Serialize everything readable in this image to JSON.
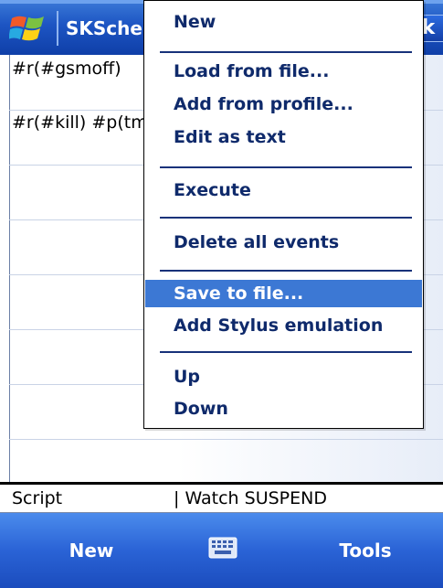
{
  "titlebar": {
    "title": "SKSchel",
    "ok_label": "k",
    "start_icon": "windows-flag-icon"
  },
  "list": {
    "rows": [
      {
        "text": "#r(#gsmoff)"
      },
      {
        "text": "#r(#kill) #p(tm"
      }
    ]
  },
  "statusbar": {
    "left": "Script",
    "right": "| Watch SUSPEND"
  },
  "menubar": {
    "left_label": "New",
    "right_label": "Tools",
    "keyboard_icon": "keyboard-icon"
  },
  "menu": {
    "items": [
      {
        "label": "New"
      },
      {
        "label": "Load from file..."
      },
      {
        "label": "Add from profile..."
      },
      {
        "label": "Edit as text"
      },
      {
        "label": "Execute"
      },
      {
        "label": "Delete all events"
      },
      {
        "label": "Save to file...",
        "selected": true
      },
      {
        "label": "Add Stylus emulation"
      },
      {
        "label": "Up"
      },
      {
        "label": "Down"
      }
    ]
  },
  "colors": {
    "titlebar": "#1d55c3",
    "menubar": "#2a63d6",
    "menu_text": "#0f2a6b",
    "selection": "#3c78d4"
  }
}
